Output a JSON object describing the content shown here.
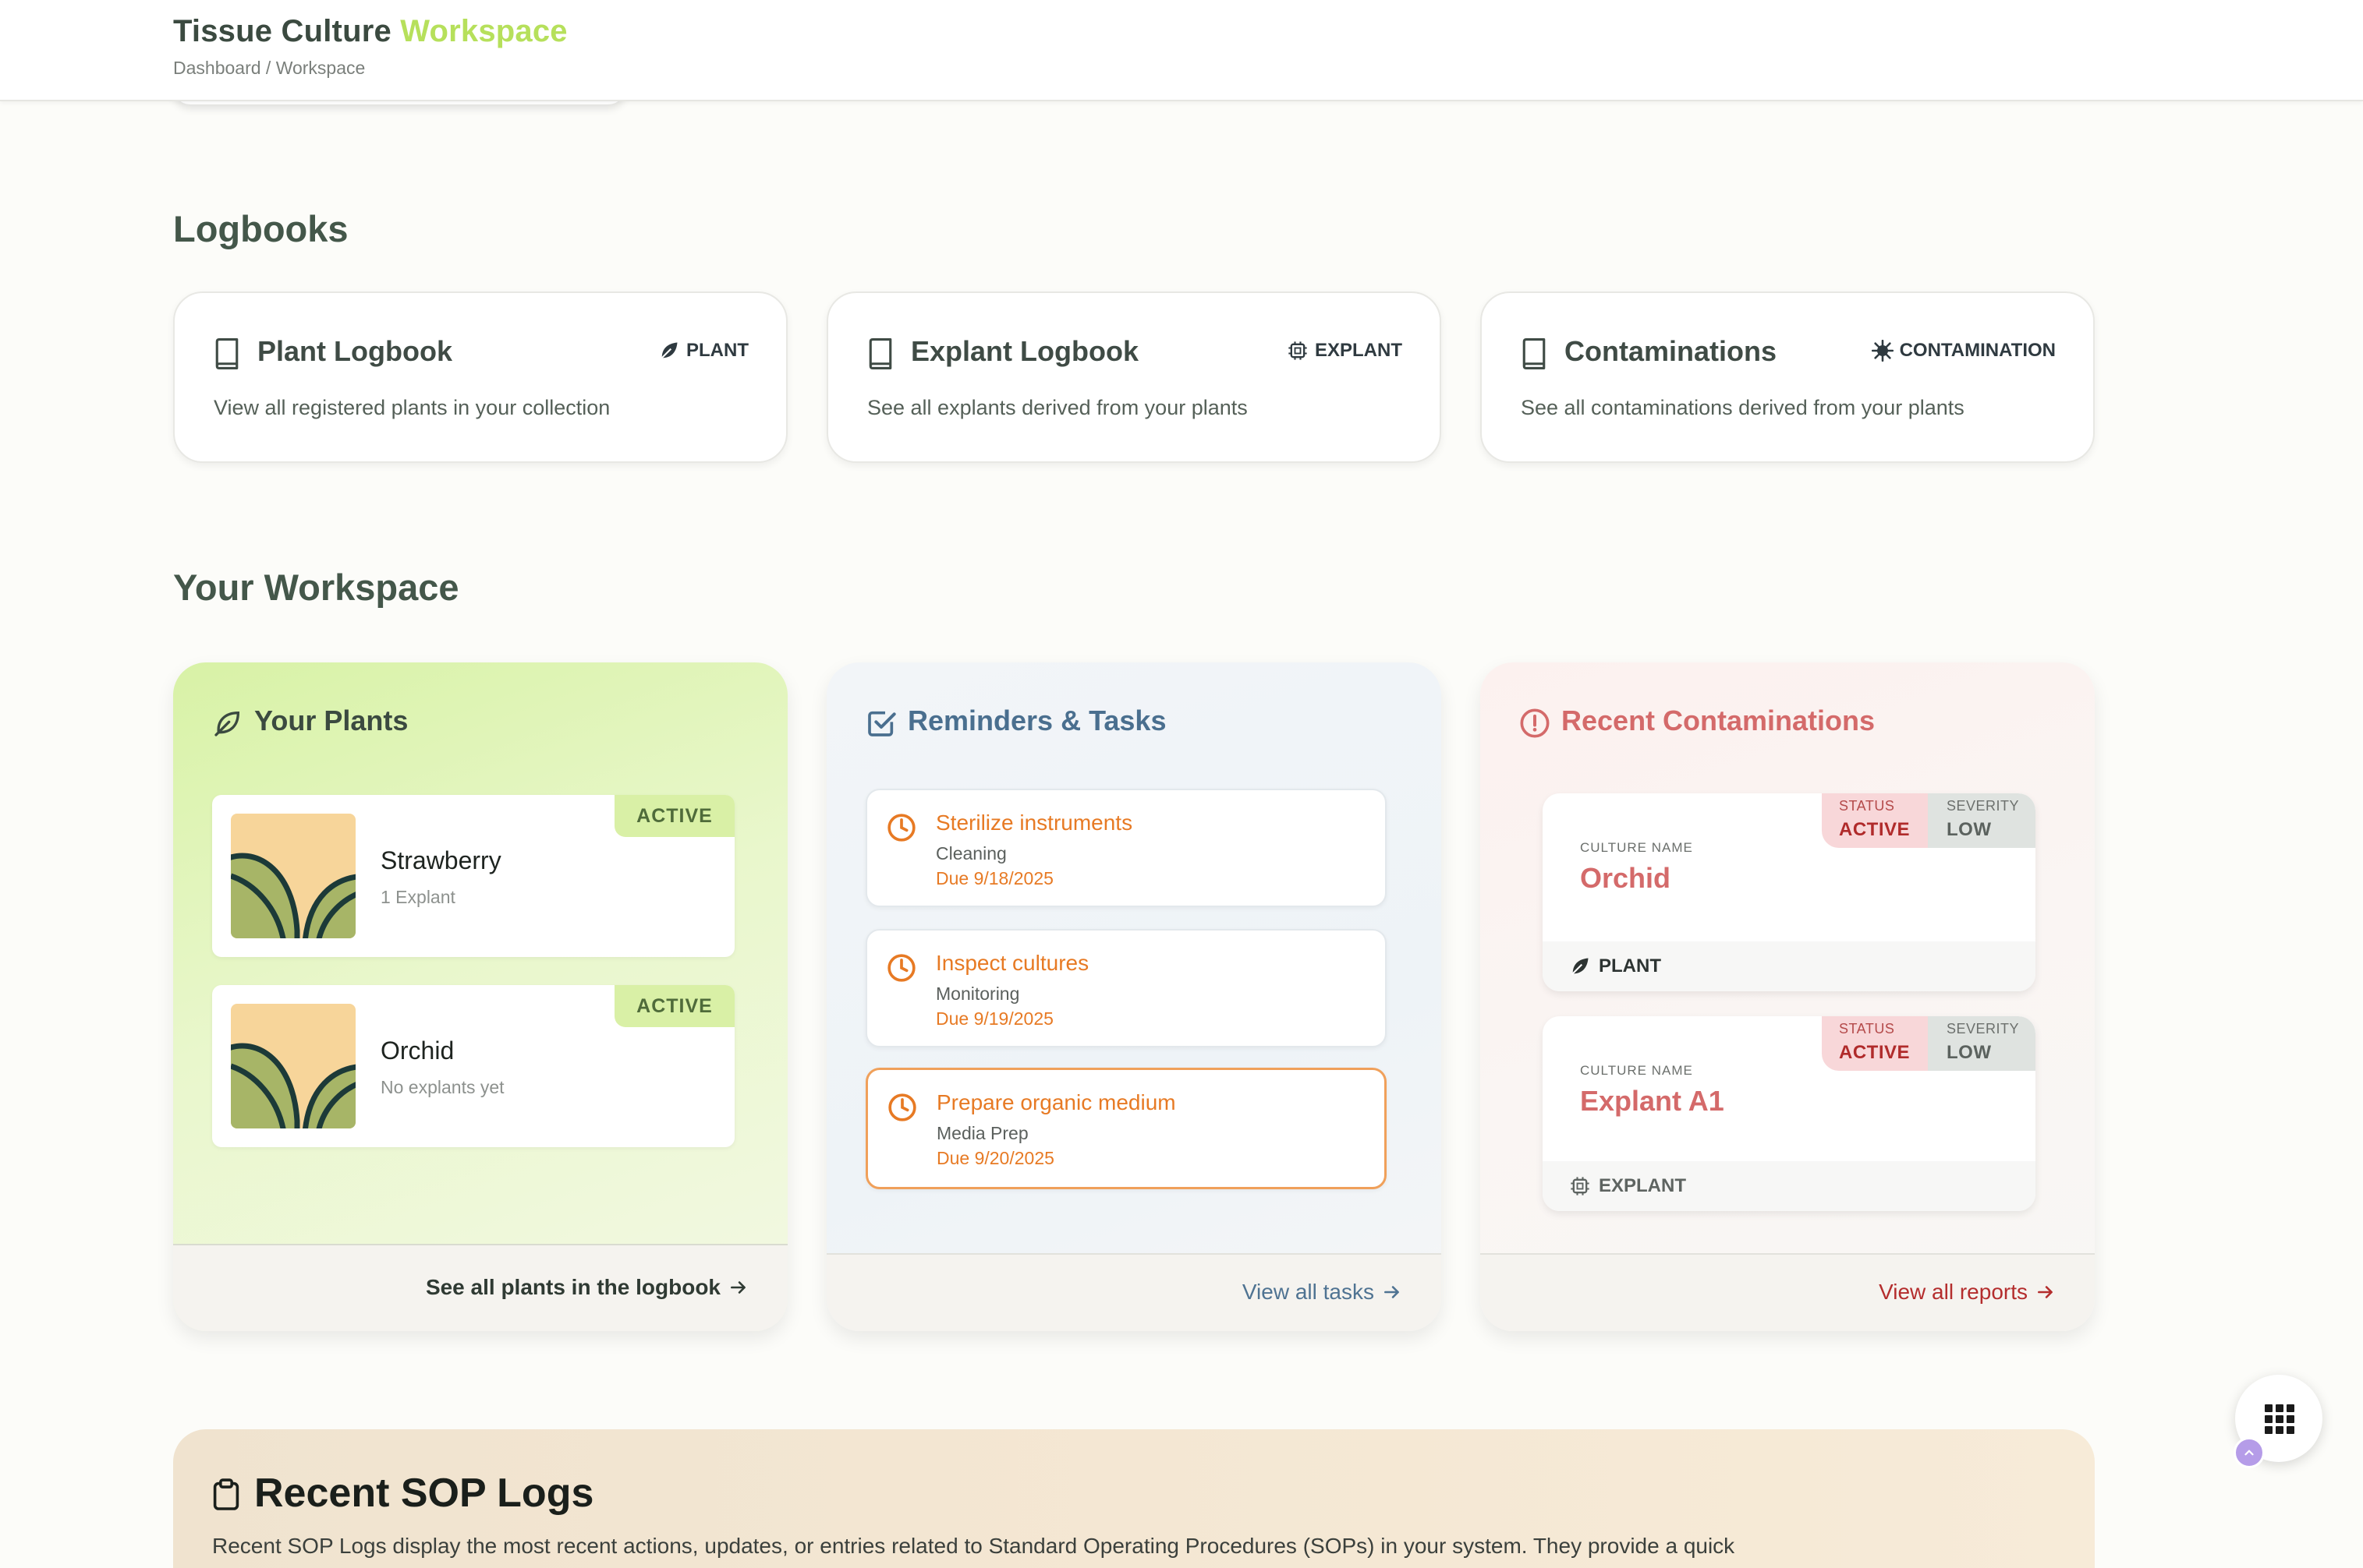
{
  "header": {
    "title_main": "Tissue Culture",
    "title_accent": "Workspace",
    "breadcrumb": "Dashboard / Workspace"
  },
  "logbooks": {
    "section_title": "Logbooks",
    "cards": [
      {
        "title": "Plant Logbook",
        "tag": "PLANT",
        "tag_icon": "leaf-icon",
        "description": "View all registered plants in your collection"
      },
      {
        "title": "Explant Logbook",
        "tag": "EXPLANT",
        "tag_icon": "chip-icon",
        "description": "See all explants derived from your plants"
      },
      {
        "title": "Contaminations",
        "tag": "CONTAMINATION",
        "tag_icon": "virus-icon",
        "description": "See all contaminations derived from your plants"
      }
    ]
  },
  "workspace": {
    "section_title": "Your Workspace",
    "plants": {
      "title": "Your Plants",
      "items": [
        {
          "name": "Strawberry",
          "subtitle": "1 Explant",
          "status": "ACTIVE"
        },
        {
          "name": "Orchid",
          "subtitle": "No explants yet",
          "status": "ACTIVE"
        }
      ],
      "footer_link": "See all plants in the logbook"
    },
    "tasks": {
      "title": "Reminders & Tasks",
      "items": [
        {
          "name": "Sterilize instruments",
          "category": "Cleaning",
          "due": "Due 9/18/2025"
        },
        {
          "name": "Inspect cultures",
          "category": "Monitoring",
          "due": "Due 9/19/2025"
        },
        {
          "name": "Prepare organic medium",
          "category": "Media Prep",
          "due": "Due 9/20/2025"
        }
      ],
      "footer_link": "View all tasks"
    },
    "contaminations": {
      "title": "Recent Contaminations",
      "items": [
        {
          "label": "CULTURE NAME",
          "name": "Orchid",
          "status_label": "STATUS",
          "status": "ACTIVE",
          "severity_label": "SEVERITY",
          "severity": "LOW",
          "type": "PLANT"
        },
        {
          "label": "CULTURE NAME",
          "name": "Explant A1",
          "status_label": "STATUS",
          "status": "ACTIVE",
          "severity_label": "SEVERITY",
          "severity": "LOW",
          "type": "EXPLANT"
        }
      ],
      "footer_link": "View all reports"
    }
  },
  "sop": {
    "title": "Recent SOP Logs",
    "description": "Recent SOP Logs display the most recent actions, updates, or entries related to Standard Operating Procedures (SOPs) in your system. They provide a quick"
  },
  "colors": {
    "accent": "#b6e05b",
    "task_orange": "#e77a24",
    "contamination_red": "#d46a6a",
    "tasks_blue": "#4a6f8f"
  }
}
